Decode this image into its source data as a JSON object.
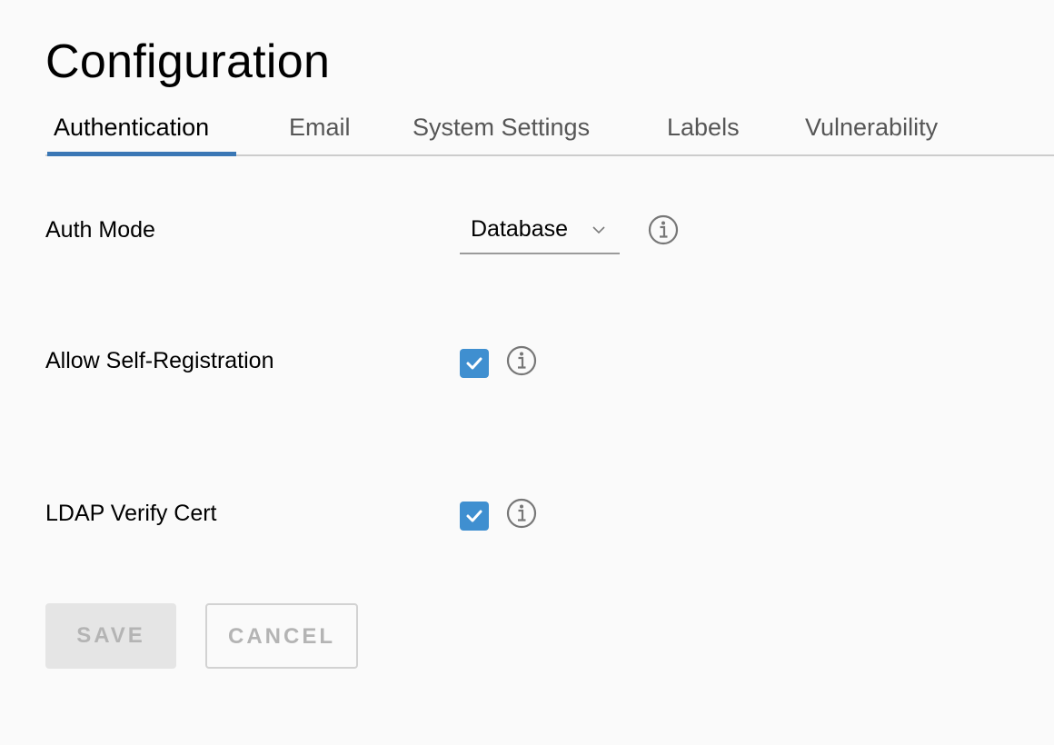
{
  "page": {
    "title": "Configuration"
  },
  "tabs": [
    {
      "label": "Authentication",
      "active": true
    },
    {
      "label": "Email",
      "active": false
    },
    {
      "label": "System Settings",
      "active": false
    },
    {
      "label": "Labels",
      "active": false
    },
    {
      "label": "Vulnerability",
      "active": false
    }
  ],
  "form": {
    "auth_mode": {
      "label": "Auth Mode",
      "value": "Database",
      "icon": "chevron-down-icon",
      "info_icon": "info-icon"
    },
    "self_registration": {
      "label": "Allow Self-Registration",
      "checked": true,
      "info_icon": "info-icon"
    },
    "ldap_verify_cert": {
      "label": "LDAP Verify Cert",
      "checked": true,
      "info_icon": "info-icon"
    }
  },
  "actions": {
    "save_label": "SAVE",
    "save_disabled": true,
    "cancel_label": "CANCEL",
    "cancel_disabled": true
  },
  "colors": {
    "accent": "#3a77b5",
    "checkbox": "#3f8fd0",
    "background": "#fafafa",
    "disabled_text": "#b4b4b4"
  }
}
